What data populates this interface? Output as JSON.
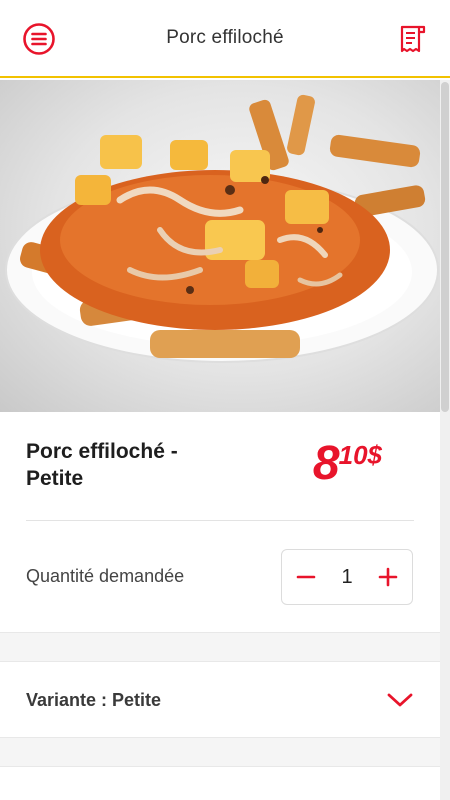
{
  "header": {
    "title": "Porc effiloché",
    "menu_icon": "menu-circle-icon",
    "receipt_icon": "receipt-icon"
  },
  "hero": {
    "image": "poutine-pulled-pork-photo"
  },
  "product": {
    "name": "Porc effiloché - Petite",
    "price_int": "8",
    "price_dec": "10",
    "price_currency": "$"
  },
  "quantity": {
    "label": "Quantité demandée",
    "value": "1"
  },
  "variant": {
    "label": "Variante : Petite",
    "chevron_icon": "chevron-down-icon"
  },
  "colors": {
    "accent_red": "#e8142b",
    "header_border": "#f2c200"
  }
}
